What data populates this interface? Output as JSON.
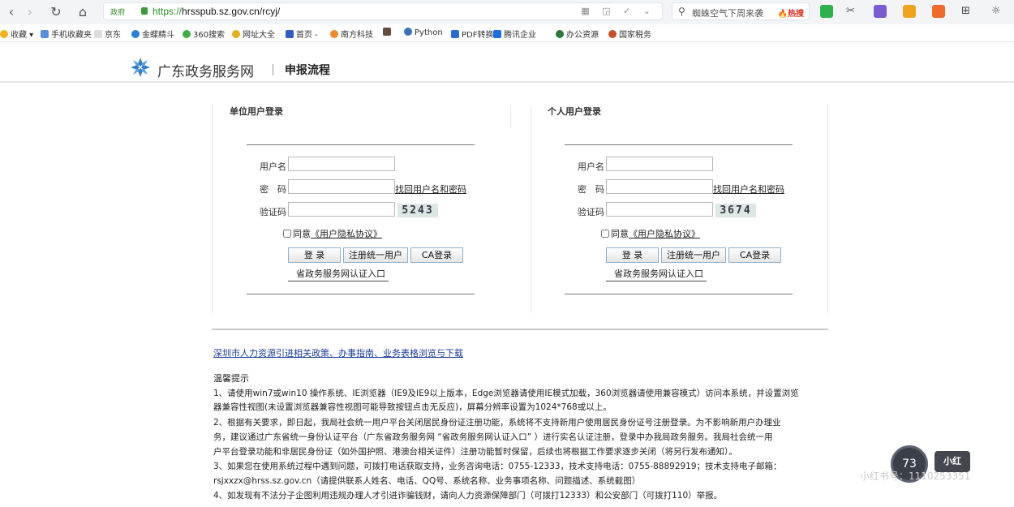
{
  "browser": {
    "url_prefix": "政府",
    "url_scheme": "https://",
    "url_host": "hrsspub.sz.gov.cn",
    "url_path": "/rcyj/",
    "search_placeholder": "蜘蛛空气下周来袭",
    "hot_label": "热搜"
  },
  "bookmarks": [
    {
      "label": "收藏"
    },
    {
      "label": "手机收藏夹"
    },
    {
      "label": "京东"
    },
    {
      "label": "金蝶精斗"
    },
    {
      "label": "360搜索"
    },
    {
      "label": "网址大全"
    },
    {
      "label": "首页 -"
    },
    {
      "label": "南方科技"
    },
    {
      "label": "Python"
    },
    {
      "label": "PDF转换"
    },
    {
      "label": "腾讯企业"
    },
    {
      "label": "办公资源"
    },
    {
      "label": "国家税务"
    }
  ],
  "header": {
    "site_title": "广东政务服务网",
    "page_title": "申报流程"
  },
  "org_login": {
    "title": "单位用户登录",
    "username_label": "用户名",
    "password_label": "密　码",
    "captcha_label": "验证码",
    "forgot_link": "找回用户名和密码",
    "captcha_code": "5243",
    "agree_text": "同意",
    "privacy_link": "《用户隐私协议》",
    "login_button": "登 录",
    "register_button": "注册统一用户",
    "ca_button": "CA登录",
    "portal_link": "省政务服务网认证入口"
  },
  "personal_login": {
    "title": "个人用户登录",
    "username_label": "用户名",
    "password_label": "密　码",
    "captcha_label": "验证码",
    "forgot_link": "找回用户名和密码",
    "captcha_code": "3674",
    "agree_text": "同意",
    "privacy_link": "《用户隐私协议》",
    "login_button": "登 录",
    "register_button": "注册统一用户",
    "ca_button": "CA登录",
    "portal_link": "省政务服务网认证入口"
  },
  "policy_link": "深圳市人力资源引进相关政策、办事指南、业务表格浏览与下载",
  "notice": {
    "title": "温馨提示",
    "lines": [
      "1、请使用win7或win10 操作系统、IE浏览器（IE9及IE9以上版本，Edge浏览器请使用IE模式加载，360浏览器请使用兼容模式）访问本系统，并设置浏览",
      "器兼容性视图(未设置浏览器兼容性视图可能导致按钮点击无反应)，屏幕分辨率设置为1024*768或以上。",
      "2、根据有关要求，即日起，我局社会统一用户平台关闭居民身份证注册功能，系统将不支持新用户使用居民身份证号注册登录。为不影响新用户办理业",
      "务，建议通过广东省统一身份认证平台（广东省政务服务网 “省政务服务网认证入口” ）进行实名认证注册，登录中办我局政务服务。我局社会统一用",
      "户平台登录功能和非居民身份证（如外国护照、港澳台相关证件）注册功能暂时保留，后续也将根据工作要求逐步关闭（将另行发布通知）。",
      "3、如果您在使用系统过程中遇到问题，可拨打电话获取支持，业务咨询电话：0755-12333，技术支持电话：0755-88892919；技术支持电子邮箱：",
      "rsjxxzx@hrss.sz.gov.cn（请提供联系人姓名、电话、QQ号、系统名称、业务事项名称、问题描述、系统截图）",
      "4、如发现有不法分子企图利用违规办理人才引进诈骗钱财，请向人力资源保障部门（可拨打12333）和公安部门（可拨打110）举报。"
    ]
  },
  "overlay": {
    "speed_value": "73",
    "badge_text": "小红",
    "watermark": "小红书号：1110253351"
  }
}
